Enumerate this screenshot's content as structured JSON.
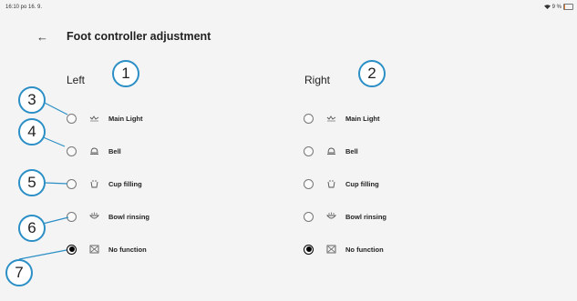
{
  "status_bar": {
    "time": "16:10  po 16. 9.",
    "battery": "9 %",
    "battery_level": 0.09
  },
  "header": {
    "title": "Foot controller adjustment"
  },
  "columns": [
    {
      "label": "Left",
      "options": [
        {
          "label": "Main Light",
          "icon": "main-light-icon",
          "selected": false
        },
        {
          "label": "Bell",
          "icon": "bell-icon",
          "selected": false
        },
        {
          "label": "Cup filling",
          "icon": "cup-filling-icon",
          "selected": false
        },
        {
          "label": "Bowl rinsing",
          "icon": "bowl-rinsing-icon",
          "selected": false
        },
        {
          "label": "No function",
          "icon": "no-function-icon",
          "selected": true
        }
      ]
    },
    {
      "label": "Right",
      "options": [
        {
          "label": "Main Light",
          "icon": "main-light-icon",
          "selected": false
        },
        {
          "label": "Bell",
          "icon": "bell-icon",
          "selected": false
        },
        {
          "label": "Cup filling",
          "icon": "cup-filling-icon",
          "selected": false
        },
        {
          "label": "Bowl rinsing",
          "icon": "bowl-rinsing-icon",
          "selected": false
        },
        {
          "label": "No function",
          "icon": "no-function-icon",
          "selected": true
        }
      ]
    }
  ],
  "callouts": [
    "1",
    "2",
    "3",
    "4",
    "5",
    "6",
    "7"
  ],
  "colors": {
    "callout_border": "#2b8fc6",
    "background": "#f4f4f4",
    "battery_fill": "#e07a2a"
  }
}
